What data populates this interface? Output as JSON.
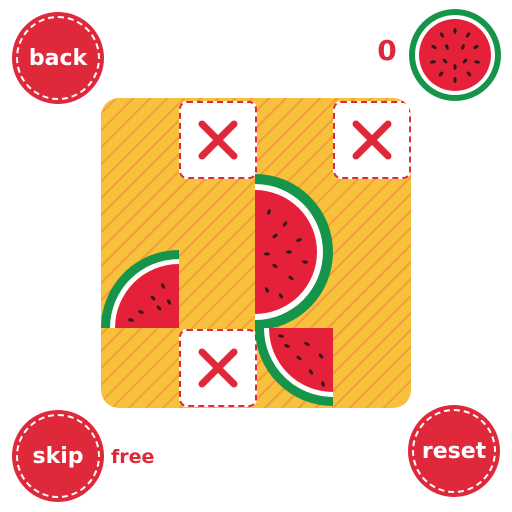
{
  "buttons": {
    "back": "back",
    "skip": "skip",
    "reset": "reset",
    "free": "free"
  },
  "score": {
    "value": "0"
  },
  "icons": {
    "score": "watermelon-icon",
    "blocked": "x-icon",
    "piece": "watermelon-slice"
  },
  "colors": {
    "accent": "#e0283b",
    "board": "#f7c13c",
    "stripe": "#f1923e",
    "rind": "#16944a",
    "flesh": "#e5213a",
    "seed": "#2b1a1a"
  }
}
